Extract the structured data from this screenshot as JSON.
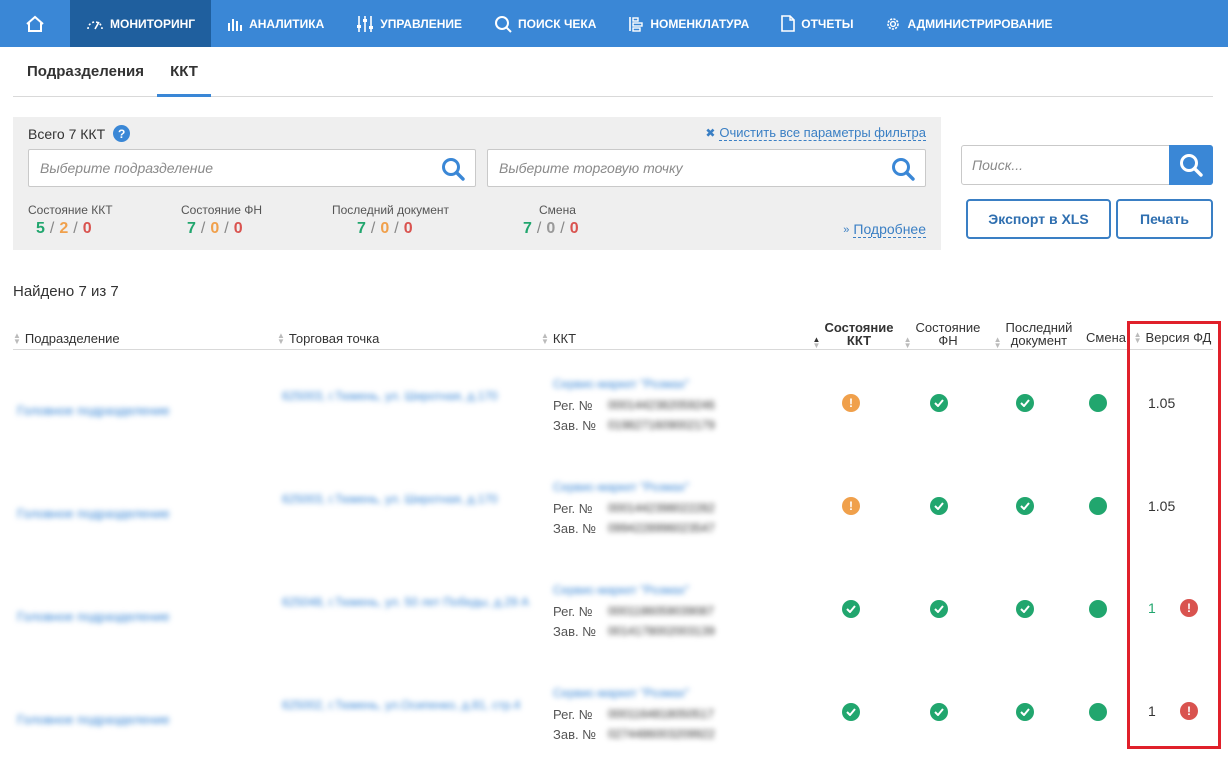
{
  "nav": {
    "items": [
      {
        "label": "Мониторинг",
        "icon": "gauge-icon"
      },
      {
        "label": "Аналитика",
        "icon": "bar-chart-icon"
      },
      {
        "label": "Управление",
        "icon": "sliders-icon"
      },
      {
        "label": "Поиск чека",
        "icon": "search-icon"
      },
      {
        "label": "Номенклатура",
        "icon": "nomenclature-icon"
      },
      {
        "label": "Отчеты",
        "icon": "document-icon"
      },
      {
        "label": "Администрирование",
        "icon": "gear-icon"
      }
    ]
  },
  "tabs": [
    "Подразделения",
    "ККТ"
  ],
  "filter": {
    "total": "Всего 7 ККТ",
    "clear": "Очистить все параметры фильтра",
    "division_placeholder": "Выберите подразделение",
    "point_placeholder": "Выберите торговую точку",
    "more": "Подробнее",
    "stats": [
      {
        "label": "Состояние ККТ",
        "v1": "5",
        "v2": "2",
        "v3": "0"
      },
      {
        "label": "Состояние ФН",
        "v1": "7",
        "v2": "0",
        "v3": "0"
      },
      {
        "label": "Последний документ",
        "v1": "7",
        "v2": "0",
        "v3": "0"
      },
      {
        "label": "Смена",
        "v1": "7",
        "v2": "0",
        "v3": "0"
      }
    ]
  },
  "search": {
    "placeholder": "Поиск..."
  },
  "buttons": {
    "export": "Экспорт в XLS",
    "print": "Печать"
  },
  "found": "Найдено 7 из 7",
  "table": {
    "headers": {
      "division": "Подразделение",
      "point": "Торговая точка",
      "kkt": "ККТ",
      "kkt_state_1": "Состояние",
      "kkt_state_2": "ККТ",
      "fn_state_1": "Состояние",
      "fn_state_2": "ФН",
      "last_doc_1": "Последний",
      "last_doc_2": "документ",
      "shift": "Смена",
      "fd_version": "Версия ФД"
    },
    "reg_label": "Рег. №",
    "serial_label": "Зав. №",
    "rows": [
      {
        "division": "Головное подразделение",
        "point": "625003, г.Тюмень, ул. Широтная, д.170",
        "kkt": "Сервис-маркет \"Розмах\"",
        "reg": "0001442382059246",
        "serial": "0198271609002179",
        "kkt_state": "warn",
        "fn_state": "ok",
        "last_doc": "ok",
        "shift": "open",
        "version": "1.05",
        "version_warn": false
      },
      {
        "division": "Головное подразделение",
        "point": "625003, г.Тюмень, ул. Широтная, д.170",
        "kkt": "Сервис-маркет \"Розмах\"",
        "reg": "0001442398022282",
        "serial": "0994228996023547",
        "kkt_state": "warn",
        "fn_state": "ok",
        "last_doc": "ok",
        "shift": "open",
        "version": "1.05",
        "version_warn": false
      },
      {
        "division": "Головное подразделение",
        "point": "625048, г.Тюмень, ул. 50 лет Победы, д.29 А",
        "kkt": "Сервис-маркет \"Розмах\"",
        "reg": "0001186059039087",
        "serial": "0014178002003139",
        "kkt_state": "ok",
        "fn_state": "ok",
        "last_doc": "ok",
        "shift": "open",
        "version": "1",
        "version_warn": true
      },
      {
        "division": "Головное подразделение",
        "point": "625002, г.Тюмень, ул.Осипенко, д.81, стр.4",
        "kkt": "Сервис-маркет \"Розмах\"",
        "reg": "0001164818050517",
        "serial": "0274486003209922",
        "kkt_state": "ok",
        "fn_state": "ok",
        "last_doc": "ok",
        "shift": "open",
        "version": "1",
        "version_warn": true
      }
    ]
  },
  "colors": {
    "primary": "#3a87d6",
    "nav_active": "#1f5f9e",
    "ok": "#21a66e",
    "warn": "#f0a04b",
    "error": "#d9534f",
    "highlight": "#e0202a"
  }
}
